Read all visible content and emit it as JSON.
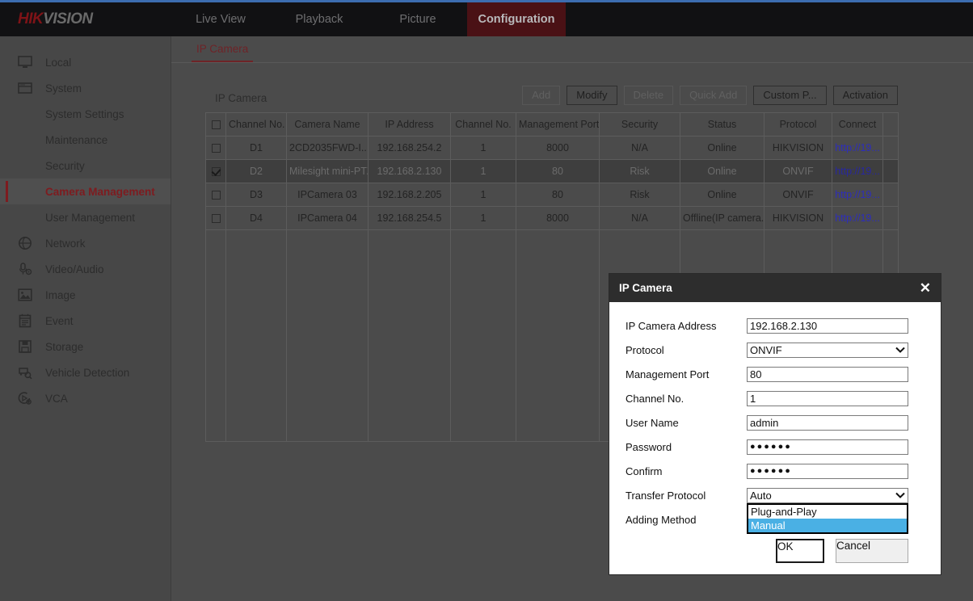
{
  "brand": {
    "name_bold": "HIK",
    "name_rest": "VISION"
  },
  "topnav": {
    "items": [
      {
        "label": "Live View",
        "active": false
      },
      {
        "label": "Playback",
        "active": false
      },
      {
        "label": "Picture",
        "active": false
      },
      {
        "label": "Configuration",
        "active": true
      }
    ]
  },
  "sidebar": {
    "items": [
      {
        "label": "Local",
        "icon": "monitor-icon",
        "sub": false,
        "selected": false
      },
      {
        "label": "System",
        "icon": "window-icon",
        "sub": false,
        "selected": false
      },
      {
        "label": "System Settings",
        "icon": "",
        "sub": true,
        "selected": false
      },
      {
        "label": "Maintenance",
        "icon": "",
        "sub": true,
        "selected": false
      },
      {
        "label": "Security",
        "icon": "",
        "sub": true,
        "selected": false
      },
      {
        "label": "Camera Management",
        "icon": "",
        "sub": true,
        "selected": true
      },
      {
        "label": "User Management",
        "icon": "",
        "sub": true,
        "selected": false
      },
      {
        "label": "Network",
        "icon": "globe-icon",
        "sub": false,
        "selected": false
      },
      {
        "label": "Video/Audio",
        "icon": "microphone-icon",
        "sub": false,
        "selected": false
      },
      {
        "label": "Image",
        "icon": "picture-icon",
        "sub": false,
        "selected": false
      },
      {
        "label": "Event",
        "icon": "calendar-icon",
        "sub": false,
        "selected": false
      },
      {
        "label": "Storage",
        "icon": "save-disk-icon",
        "sub": false,
        "selected": false
      },
      {
        "label": "Vehicle Detection",
        "icon": "vehicle-search-icon",
        "sub": false,
        "selected": false
      },
      {
        "label": "VCA",
        "icon": "vca-icon",
        "sub": false,
        "selected": false
      }
    ]
  },
  "tabs": [
    {
      "label": "IP Camera",
      "active": true
    }
  ],
  "panel": {
    "title": "IP Camera",
    "buttons": [
      {
        "label": "Add",
        "disabled": true
      },
      {
        "label": "Modify",
        "disabled": false
      },
      {
        "label": "Delete",
        "disabled": true
      },
      {
        "label": "Quick Add",
        "disabled": true
      },
      {
        "label": "Custom P...",
        "disabled": false
      },
      {
        "label": "Activation",
        "disabled": false
      }
    ]
  },
  "table": {
    "columns": [
      "",
      "Channel No.",
      "Camera Name",
      "IP Address",
      "Channel No.",
      "Management Port",
      "Security",
      "Status",
      "Protocol",
      "Connect",
      ""
    ],
    "rows": [
      {
        "checked": false,
        "selected": false,
        "channel_no": "D1",
        "camera_name": "2CD2035FWD-I...",
        "ip_address": "192.168.254.2",
        "channel_no_2": "1",
        "management_port": "8000",
        "security": "N/A",
        "status": "Online",
        "protocol": "HIKVISION",
        "connect": "http://19..."
      },
      {
        "checked": true,
        "selected": true,
        "channel_no": "D2",
        "camera_name": "Milesight mini-PTZ",
        "ip_address": "192.168.2.130",
        "channel_no_2": "1",
        "management_port": "80",
        "security": "Risk",
        "status": "Online",
        "protocol": "ONVIF",
        "connect": "http://19..."
      },
      {
        "checked": false,
        "selected": false,
        "channel_no": "D3",
        "camera_name": "IPCamera 03",
        "ip_address": "192.168.2.205",
        "channel_no_2": "1",
        "management_port": "80",
        "security": "Risk",
        "status": "Online",
        "protocol": "ONVIF",
        "connect": "http://19..."
      },
      {
        "checked": false,
        "selected": false,
        "channel_no": "D4",
        "camera_name": "IPCamera 04",
        "ip_address": "192.168.254.5",
        "channel_no_2": "1",
        "management_port": "8000",
        "security": "N/A",
        "status": "Offline(IP camera...",
        "protocol": "HIKVISION",
        "connect": "http://19..."
      }
    ],
    "empty_rows": 1
  },
  "dialog": {
    "title": "IP Camera",
    "close_glyph": "✕",
    "fields": {
      "ip_camera_address": {
        "label": "IP Camera Address",
        "value": "192.168.2.130"
      },
      "protocol": {
        "label": "Protocol",
        "value": "ONVIF"
      },
      "management_port": {
        "label": "Management Port",
        "value": "80"
      },
      "channel_no": {
        "label": "Channel No.",
        "value": "1"
      },
      "user_name": {
        "label": "User Name",
        "value": "admin"
      },
      "password": {
        "label": "Password",
        "value": "●●●●●●"
      },
      "confirm": {
        "label": "Confirm",
        "value": "●●●●●●"
      },
      "transfer_protocol": {
        "label": "Transfer Protocol",
        "value": "Auto"
      },
      "adding_method": {
        "label": "Adding Method",
        "value": "Manual"
      }
    },
    "adding_method_options": [
      {
        "label": "Plug-and-Play",
        "highlighted": false
      },
      {
        "label": "Manual",
        "highlighted": true
      }
    ],
    "ok_label": "OK",
    "cancel_label": "Cancel"
  },
  "colors": {
    "accent_red": "#7e1b1f",
    "nav_active_bg": "#4a1115",
    "page_bg": "#4b4b4b",
    "sidebar_bg": "#474747",
    "dialog_header": "#2d2d2d",
    "dropdown_highlight": "#4ab0e4",
    "link": "#2d2dbb",
    "top_rule": "#3c6db0"
  }
}
